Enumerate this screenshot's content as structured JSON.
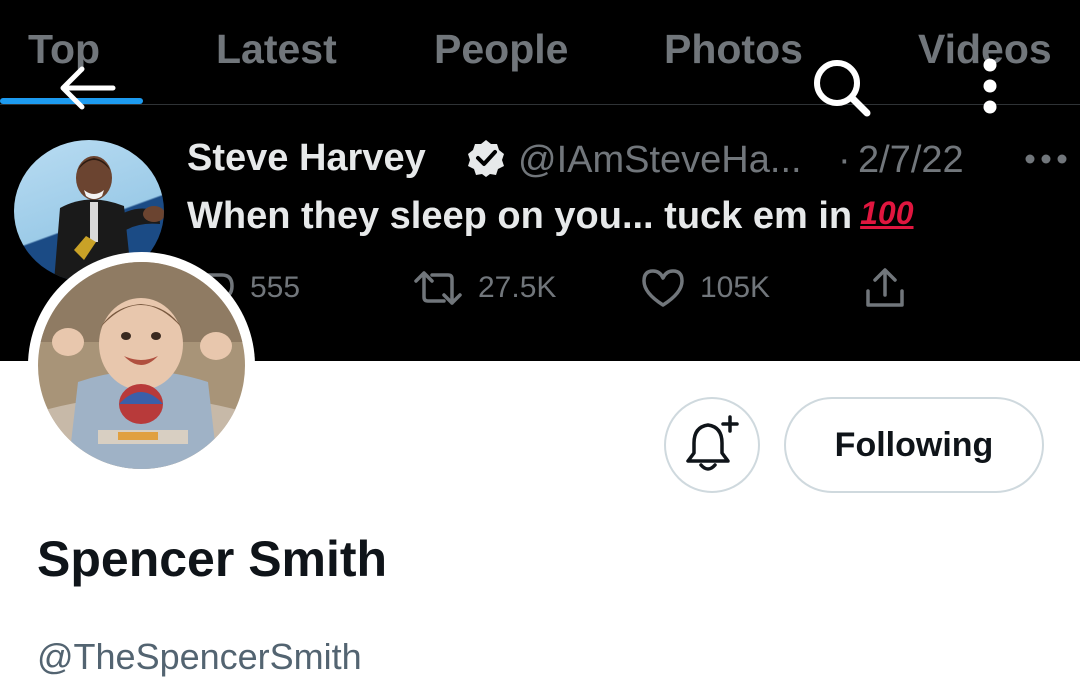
{
  "search_tabs": [
    {
      "label": "Top",
      "active": true
    },
    {
      "label": "Latest"
    },
    {
      "label": "People"
    },
    {
      "label": "Photos"
    },
    {
      "label": "Videos"
    }
  ],
  "header_icons": {
    "back": "arrow-left-icon",
    "search": "search-icon",
    "more": "more-vertical-icon"
  },
  "tweet": {
    "author_name": "Steve Harvey",
    "verified": true,
    "handle": "@IAmSteveHa...",
    "separator": "·",
    "date": "2/7/22",
    "text": "When they sleep on you... tuck em in",
    "emoji": "100",
    "replies": "555",
    "retweets": "27.5K",
    "likes": "105K"
  },
  "profile": {
    "display_name": "Spencer Smith",
    "username": "@TheSpencerSmith",
    "following_label": "Following"
  },
  "colors": {
    "accent": "#1d9bf0",
    "banner_bg": "#000000",
    "muted_dark": "#71767b",
    "text_primary": "#0f1419",
    "text_secondary": "#536471",
    "button_border": "#cfd9de",
    "emoji_red": "#e0163f"
  }
}
